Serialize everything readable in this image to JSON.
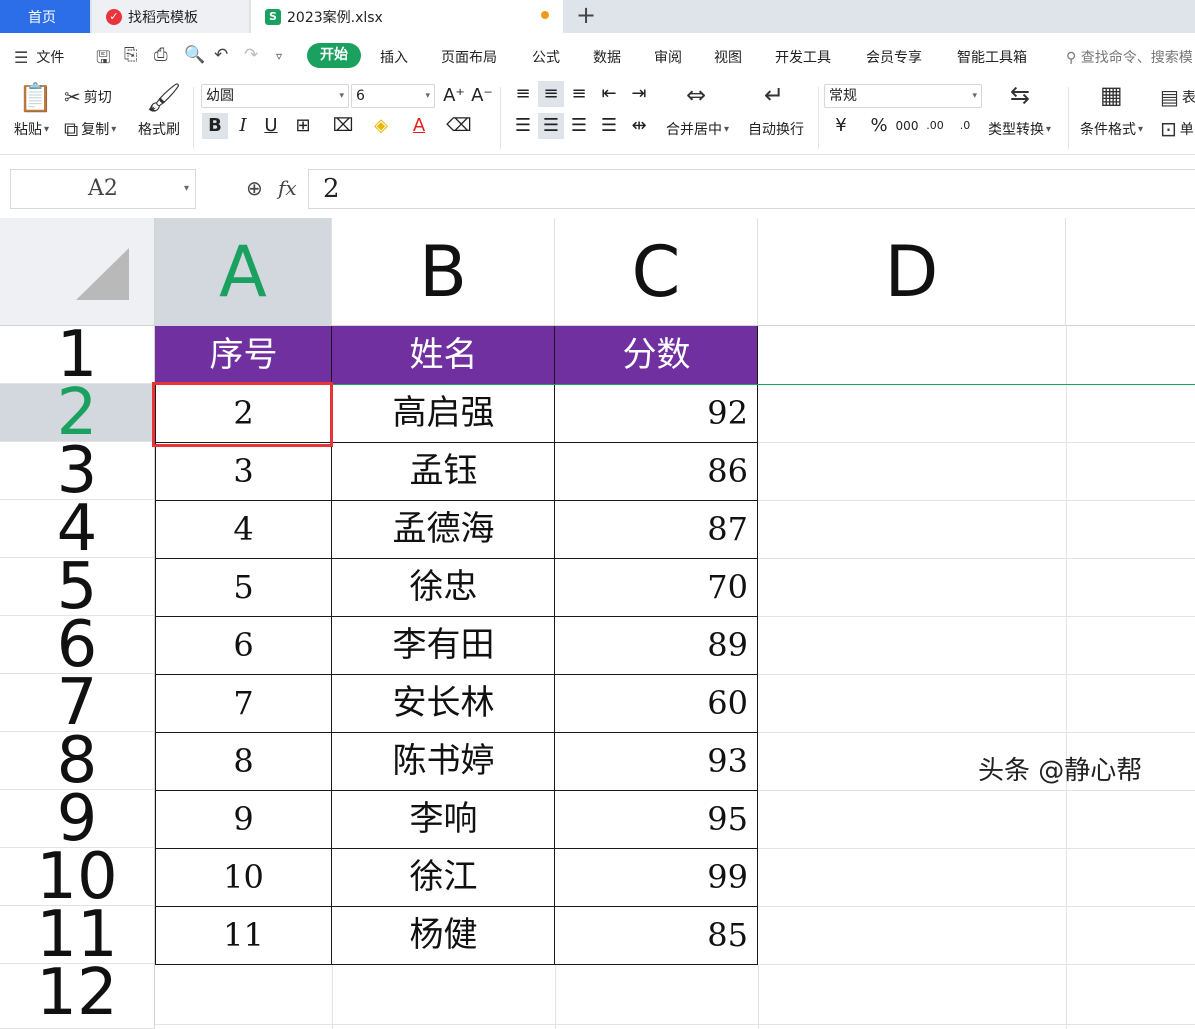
{
  "tabs": [
    {
      "label": "首页"
    },
    {
      "label": "找稻壳模板"
    },
    {
      "label": "2023案例.xlsx"
    }
  ],
  "menu": {
    "file_label": "文件",
    "items": [
      "开始",
      "插入",
      "页面布局",
      "公式",
      "数据",
      "审阅",
      "视图",
      "开发工具",
      "会员专享",
      "智能工具箱"
    ],
    "search_placeholder": "查找命令、搜索模"
  },
  "ribbon": {
    "paste": "粘贴",
    "cut": "剪切",
    "copy": "复制",
    "format_painter": "格式刷",
    "font_name": "幼圆",
    "font_size": "6",
    "merge_center": "合并居中",
    "wrap_text": "自动换行",
    "number_format": "常规",
    "type_convert": "类型转换",
    "conditional_format": "条件格式",
    "table_style": "表",
    "cell_label": "单"
  },
  "formula_bar": {
    "name_box": "A2",
    "fx": "fx",
    "value": "2"
  },
  "columns": [
    "A",
    "B",
    "C",
    "D"
  ],
  "rows": [
    "1",
    "2",
    "3",
    "4",
    "5",
    "6",
    "7",
    "8",
    "9",
    "10",
    "11",
    "12"
  ],
  "table": {
    "headers": [
      "序号",
      "姓名",
      "分数"
    ],
    "rows": [
      [
        "2",
        "高启强",
        "92"
      ],
      [
        "3",
        "孟钰",
        "86"
      ],
      [
        "4",
        "孟德海",
        "87"
      ],
      [
        "5",
        "徐忠",
        "70"
      ],
      [
        "6",
        "李有田",
        "89"
      ],
      [
        "7",
        "安长林",
        "60"
      ],
      [
        "8",
        "陈书婷",
        "93"
      ],
      [
        "9",
        "李响",
        "95"
      ],
      [
        "10",
        "徐江",
        "99"
      ],
      [
        "11",
        "杨健",
        "85"
      ]
    ]
  },
  "colors": {
    "accent_green": "#1aa160",
    "header_purple": "#7030a0",
    "selection_red": "#e8333a",
    "home_tab_blue": "#2b6ee8"
  },
  "watermark": "头条 @静心帮"
}
